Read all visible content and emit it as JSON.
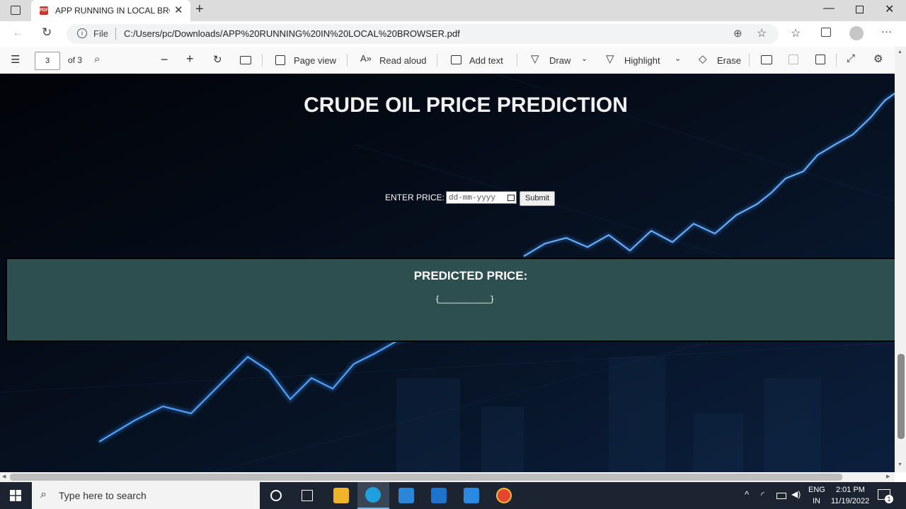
{
  "browser": {
    "tab_title": "APP RUNNING IN LOCAL BROWSER",
    "url_scheme": "File",
    "url": "C:/Users/pc/Downloads/APP%20RUNNING%20IN%20LOCAL%20BROWSER.pdf"
  },
  "pdf_toolbar": {
    "page_current": "3",
    "page_total": "of 3",
    "page_view": "Page view",
    "read_aloud": "Read aloud",
    "add_text": "Add text",
    "draw": "Draw",
    "highlight": "Highlight",
    "erase": "Erase"
  },
  "app": {
    "title": "CRUDE OIL PRICE PREDICTION",
    "enter_label": "ENTER PRICE:",
    "date_placeholder": "dd-mm-yyyy",
    "submit_label": "Submit",
    "predicted_title": "PREDICTED PRICE:",
    "predicted_value": "{___________}"
  },
  "taskbar": {
    "search_placeholder": "Type here to search",
    "language_top": "ENG",
    "language_bottom": "IN",
    "time": "2:01 PM",
    "date": "11/19/2022",
    "notification_count": "1"
  },
  "colors": {
    "prediction_panel": "#2e4f4f",
    "chart_glow": "#2f8cff"
  }
}
